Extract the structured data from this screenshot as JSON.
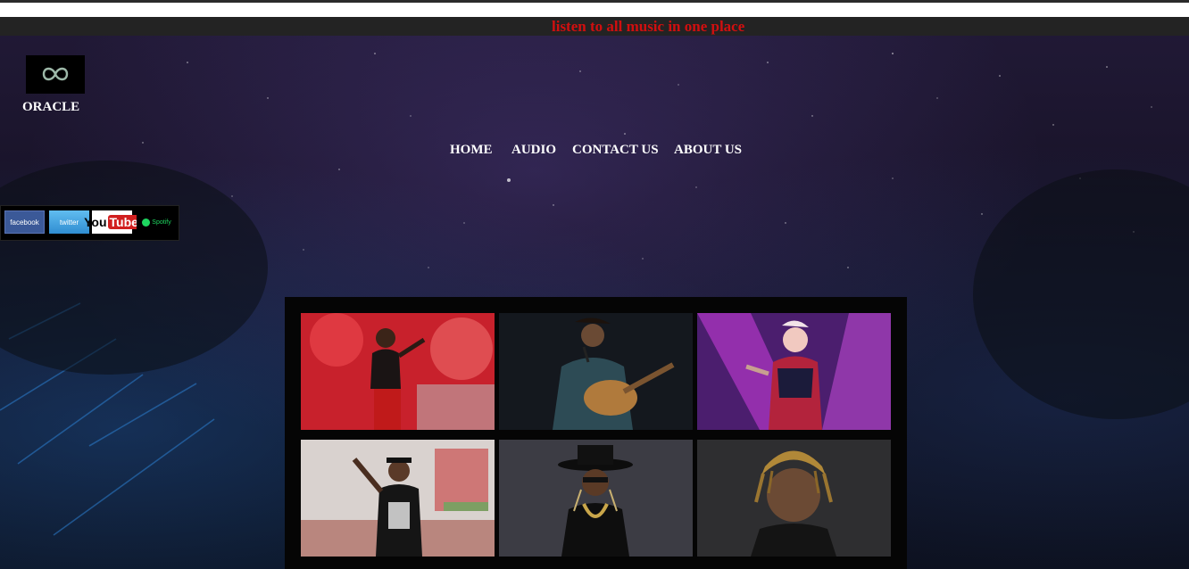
{
  "banner": {
    "marquee_text": "listen to all music in one place"
  },
  "brand": {
    "logo_icon": "infinity-logo-icon",
    "name": "ORACLE"
  },
  "nav": {
    "items": [
      {
        "label": "HOME"
      },
      {
        "label": "AUDIO"
      },
      {
        "label": "CONTACT US"
      },
      {
        "label": "ABOUT US"
      }
    ]
  },
  "social": {
    "facebook_label": "facebook",
    "twitter_label": "twitter",
    "youtube_label": "You",
    "youtube_label_tube": "Tube",
    "spotify_label": "Spotify"
  },
  "gallery": {
    "photos": [
      {
        "subject": "female singer on red stage"
      },
      {
        "subject": "male singer with acoustic guitar"
      },
      {
        "subject": "female rapper with purple lights"
      },
      {
        "subject": "rapper with cap performing"
      },
      {
        "subject": "rapper with black hat and chain"
      },
      {
        "subject": "rapper with dreadlocks portrait"
      }
    ]
  },
  "colors": {
    "marquee_text": "#d10f0f",
    "marquee_bar": "#232323",
    "page_bg": "#171226"
  }
}
